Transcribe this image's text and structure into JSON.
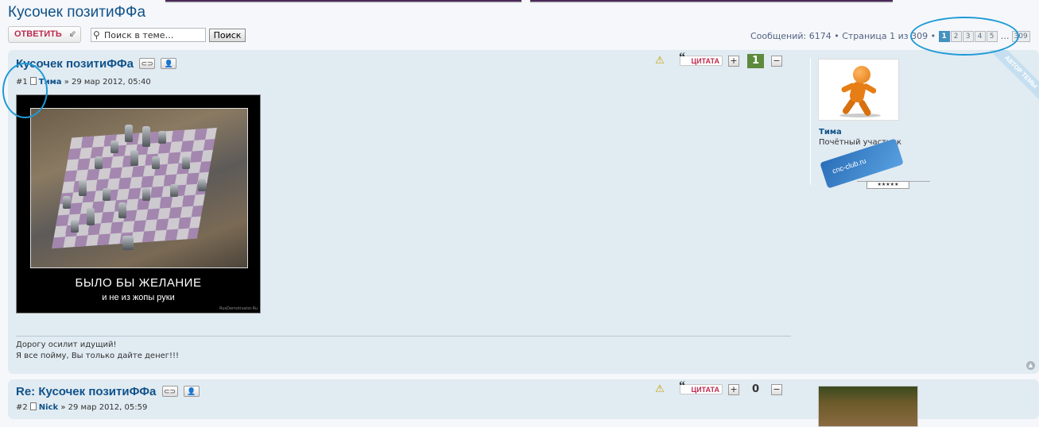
{
  "page": {
    "title": "Кусочек позитиФФа"
  },
  "action_bar": {
    "reply_label": "ОТВЕТИТЬ",
    "search_placeholder": "Поиск в теме…",
    "search_button": "Поиск"
  },
  "pagination": {
    "summary": "Сообщений: 6174 • Страница 1 из 309 •",
    "pages": [
      "1",
      "2",
      "3",
      "4",
      "5"
    ],
    "active_page": "1",
    "ellipsis": "…",
    "last_page": "309"
  },
  "posts": [
    {
      "number": "#1",
      "title": "Кусочек позитиФФа",
      "author": "Тима",
      "date": "» 29 мар 2012, 05:40",
      "quote_label": "ЦИТАТА",
      "score": "1",
      "image_caption_main": "БЫЛО БЫ ЖЕЛАНИЕ",
      "image_caption_sub": "и не из жопы руки",
      "image_watermark": "RusDemotivator.Ru",
      "signature_lines": [
        "Дорогу осилит идущий!",
        "Я все пойму, Вы только дайте денег!!!"
      ],
      "profile": {
        "name": "Тима",
        "rank": "Почётный участник",
        "rank_badge_text": "cnc-club.ru",
        "stars": "★★★★★",
        "ribbon": "АВТОР ТЕМЫ"
      }
    },
    {
      "number": "#2",
      "title": "Re: Кусочек позитиФФа",
      "author": "Nick",
      "date": "» 29 мар 2012, 05:59",
      "quote_label": "ЦИТАТА",
      "score": "0"
    }
  ],
  "icons": {
    "search": "search-icon",
    "reply": "reply-arrow-icon",
    "link": "link-icon",
    "user": "user-icon",
    "warn": "warning-icon",
    "quote": "quote-icon",
    "plus": "plus-icon",
    "minus": "minus-icon",
    "post": "post-icon",
    "top": "back-to-top-icon"
  },
  "colors": {
    "title": "#105289",
    "reply": "#bc2a4d",
    "post_bg": "#e1ebf2",
    "positive_score": "#5d8a3c",
    "active_page": "#4692bf",
    "annotation": "#1e9ad6"
  }
}
